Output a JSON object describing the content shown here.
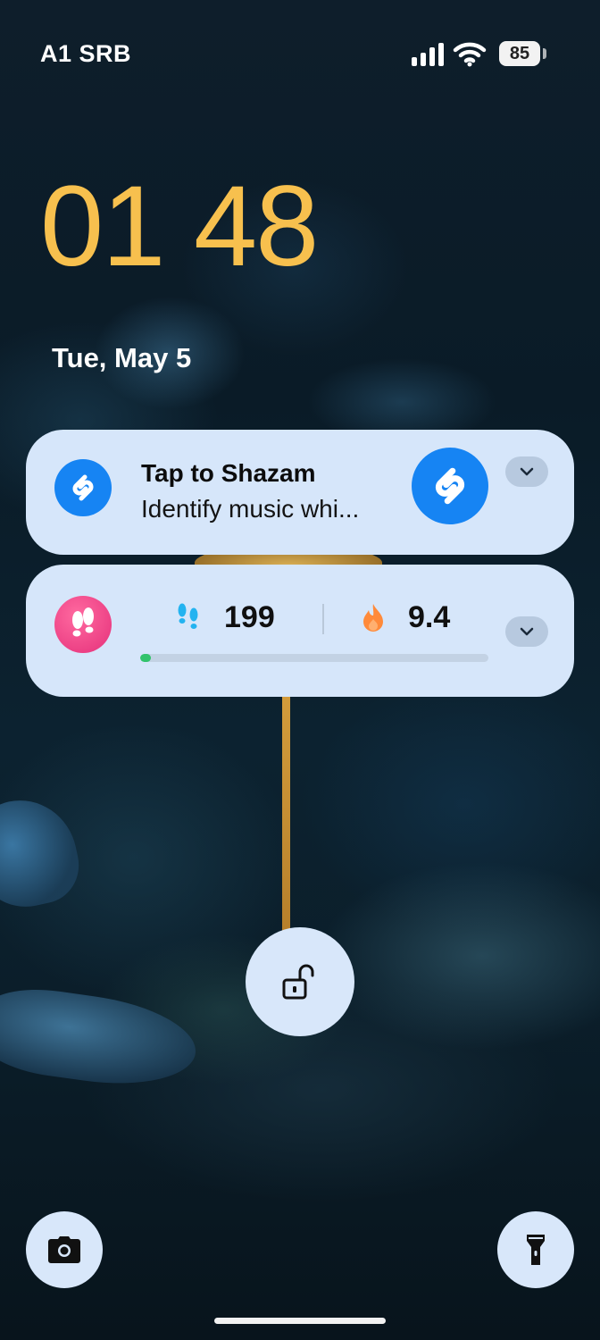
{
  "status_bar": {
    "carrier": "A1 SRB",
    "battery": "85",
    "icons": [
      "signal-icon",
      "wifi-icon",
      "battery-icon"
    ]
  },
  "lockscreen": {
    "time": "01 48",
    "date": "Tue, May 5",
    "clock_color": "#f7c04e"
  },
  "notifications": [
    {
      "app": "Shazam",
      "title": "Tap to Shazam",
      "text": "Identify music whi...",
      "icon": "shazam-icon",
      "accent": "#1684f3"
    },
    {
      "app": "Fitness",
      "icon": "footsteps-app-icon",
      "steps": "199",
      "steps_icon": "footprints-icon",
      "calories": "9.4",
      "calories_icon": "flame-icon",
      "progress": 0.03,
      "progress_color": "#32c36c"
    }
  ],
  "actions": {
    "unlock_icon": "unlock-icon",
    "left_shortcut_icon": "camera-icon",
    "right_shortcut_icon": "flashlight-icon"
  },
  "theme": {
    "card_bg": "#d6e6fa",
    "button_bg": "#d8e7fa"
  }
}
